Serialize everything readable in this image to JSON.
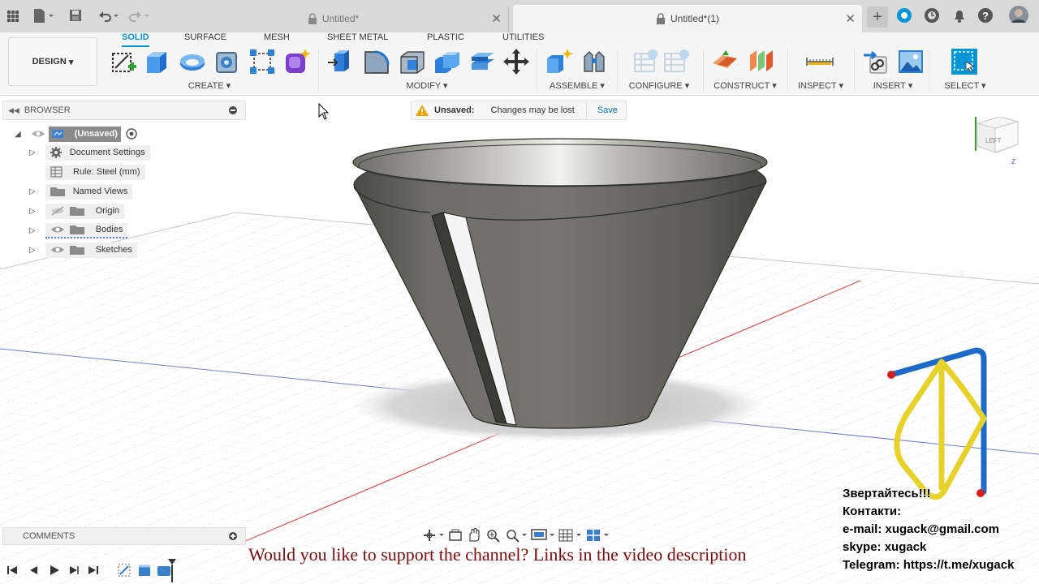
{
  "tabs": [
    {
      "label": "Untitled*",
      "active": false
    },
    {
      "label": "Untitled*(1)",
      "active": true
    }
  ],
  "workspace": {
    "label": "DESIGN"
  },
  "toolbar": {
    "tabs": [
      "SOLID",
      "SURFACE",
      "MESH",
      "SHEET METAL",
      "PLASTIC",
      "UTILITIES"
    ],
    "groups": [
      "CREATE",
      "MODIFY",
      "ASSEMBLE",
      "CONFIGURE",
      "CONSTRUCT",
      "INSPECT",
      "INSERT",
      "SELECT"
    ]
  },
  "browser": {
    "title": "BROWSER",
    "root": "(Unsaved)",
    "items": [
      "Document Settings",
      "Rule: Steel (mm)",
      "Named Views",
      "Origin",
      "Bodies",
      "Sketches"
    ]
  },
  "banner": {
    "status": "Unsaved:",
    "message": "Changes may be lost",
    "action": "Save"
  },
  "viewcube": {
    "face": "LEFT",
    "axis": "Z"
  },
  "comments": {
    "title": "COMMENTS"
  },
  "overlay": {
    "message": "Would you like to support the channel? Links in the video description"
  },
  "contacts": [
    "Звертайтесь!!!",
    "Контакти:",
    "e-mail: xugack@gmail.com",
    "skype: xugack",
    "Telegram: https://t.me/xugack"
  ],
  "colors": {
    "accent": "#0696d7",
    "body": "#6e6e66",
    "xaxis": "#e05050",
    "zaxis": "#3a56c8",
    "warning": "#f0a400"
  }
}
